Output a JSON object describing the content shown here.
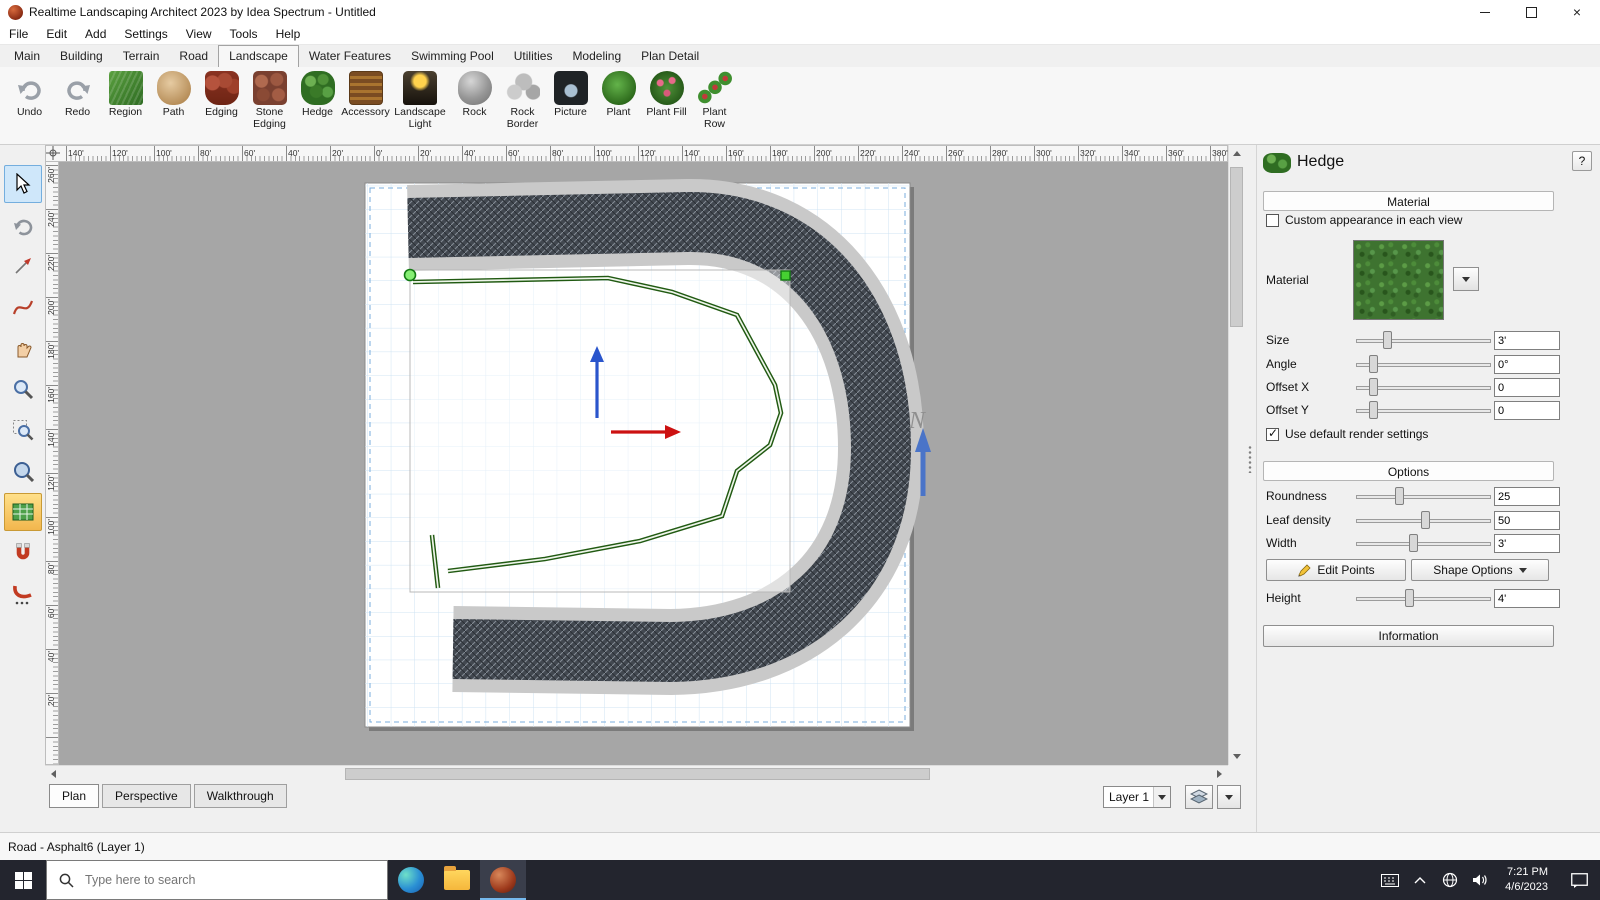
{
  "window": {
    "title": "Realtime Landscaping Architect 2023 by Idea Spectrum - Untitled"
  },
  "menu_bar": {
    "items": [
      "File",
      "Edit",
      "Add",
      "Settings",
      "View",
      "Tools",
      "Help"
    ]
  },
  "ribbon": {
    "tabs": [
      "Main",
      "Building",
      "Terrain",
      "Road",
      "Landscape",
      "Water Features",
      "Swimming Pool",
      "Utilities",
      "Modeling",
      "Plan Detail"
    ],
    "active_tab": "Landscape"
  },
  "toolbar": {
    "items": [
      {
        "label": "Undo",
        "icon": "undo-icon"
      },
      {
        "label": "Redo",
        "icon": "redo-icon"
      },
      {
        "label": "Region",
        "icon": "region-icon"
      },
      {
        "label": "Path",
        "icon": "path-icon"
      },
      {
        "label": "Edging",
        "icon": "edging-icon"
      },
      {
        "label": "Stone Edging",
        "icon": "stone-edging-icon"
      },
      {
        "label": "Hedge",
        "icon": "hedge-icon"
      },
      {
        "label": "Accessory",
        "icon": "accessory-icon"
      },
      {
        "label": "Landscape Light",
        "icon": "landscape-light-icon"
      },
      {
        "label": "Rock",
        "icon": "rock-icon"
      },
      {
        "label": "Rock Border",
        "icon": "rock-border-icon"
      },
      {
        "label": "Picture",
        "icon": "picture-icon"
      },
      {
        "label": "Plant",
        "icon": "plant-icon"
      },
      {
        "label": "Plant Fill",
        "icon": "plant-fill-icon"
      },
      {
        "label": "Plant Row",
        "icon": "plant-row-icon"
      }
    ]
  },
  "rulers": {
    "horizontal_labels": [
      "140'",
      "120'",
      "100'",
      "80'",
      "60'",
      "40'",
      "20'",
      "0'",
      "20'",
      "40'",
      "60'",
      "80'",
      "100'",
      "120'",
      "140'",
      "160'",
      "180'",
      "200'",
      "220'",
      "240'",
      "260'",
      "280'",
      "300'",
      "320'",
      "340'",
      "360'",
      "380'"
    ],
    "vertical_labels": [
      "260'",
      "240'",
      "220'",
      "200'",
      "180'",
      "160'",
      "140'",
      "120'",
      "100'",
      "80'",
      "60'",
      "40'",
      "20'"
    ]
  },
  "canvas": {
    "north_label": "N"
  },
  "hedge_panel": {
    "title": "Hedge",
    "help_label": "?",
    "material_header": "Material",
    "custom_appearance_label": "Custom appearance in each view",
    "material_label": "Material",
    "size": {
      "label": "Size",
      "value": "3'"
    },
    "angle": {
      "label": "Angle",
      "value": "0°"
    },
    "offset_x": {
      "label": "Offset X",
      "value": "0"
    },
    "offset_y": {
      "label": "Offset Y",
      "value": "0"
    },
    "use_default_label": "Use default render settings",
    "options_header": "Options",
    "roundness": {
      "label": "Roundness",
      "value": "25"
    },
    "leaf_density": {
      "label": "Leaf density",
      "value": "50"
    },
    "width": {
      "label": "Width",
      "value": "3'"
    },
    "edit_points_label": "Edit Points",
    "shape_options_label": "Shape Options",
    "height": {
      "label": "Height",
      "value": "4'"
    },
    "information_label": "Information"
  },
  "bottom_bar": {
    "view_tabs": [
      "Plan",
      "Perspective",
      "Walkthrough"
    ],
    "active_view_tab": "Plan",
    "layer_value": "Layer 1"
  },
  "status_bar": {
    "text": "Road - Asphalt6 (Layer 1)"
  },
  "taskbar": {
    "search_placeholder": "Type here to search",
    "clock_time": "7:21 PM",
    "clock_date": "4/6/2023"
  }
}
